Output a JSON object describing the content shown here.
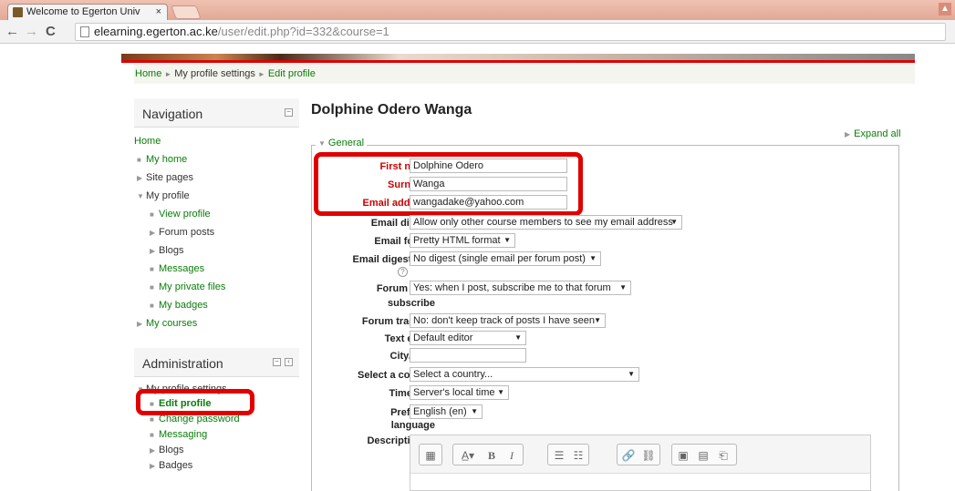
{
  "browser": {
    "tab_title": "Welcome to Egerton Univ",
    "tab_close": "×",
    "url_host": "elearning.egerton.ac.ke",
    "url_path": "/user/edit.php?id=332&course=1"
  },
  "breadcrumb": {
    "home": "Home",
    "profile_settings": "My profile settings",
    "current": "Edit profile",
    "separator": "►"
  },
  "navigation": {
    "title": "Navigation",
    "home": "Home",
    "my_home": "My home",
    "site_pages": "Site pages",
    "my_profile": "My profile",
    "view_profile": "View profile",
    "forum_posts": "Forum posts",
    "blogs": "Blogs",
    "messages": "Messages",
    "private_files": "My private files",
    "badges": "My badges",
    "my_courses": "My courses"
  },
  "administration": {
    "title": "Administration",
    "profile_settings": "My profile settings",
    "edit_profile": "Edit profile",
    "change_password": "Change password",
    "messaging": "Messaging",
    "blogs": "Blogs",
    "badges": "Badges"
  },
  "main": {
    "title": "Dolphine Odero Wanga",
    "expand_all": "Expand all",
    "section": "General"
  },
  "form": {
    "first_name_label": "First name",
    "first_name": "Dolphine Odero",
    "surname_label": "Surname",
    "surname": "Wanga",
    "email_label": "Email address",
    "email": "wangadake@yahoo.com",
    "email_display_label": "Email display",
    "email_display": "Allow only other course members to see my email address",
    "email_format_label": "Email format",
    "email_format": "Pretty HTML format",
    "digest_label": "Email digest type",
    "digest": "No digest (single email per forum post)",
    "autosub_label_1": "Forum auto-",
    "autosub_label_2": "subscribe",
    "autosub": "Yes: when I post, subscribe me to that forum",
    "tracking_label": "Forum tracking",
    "tracking": "No: don't keep track of posts I have seen",
    "editor_label": "Text editor",
    "editor": "Default editor",
    "city_label": "City/town",
    "city": "",
    "country_label": "Select a country",
    "country": "Select a country...",
    "timezone_label": "Timezone",
    "timezone": "Server's local time",
    "language_label_1": "Preferred",
    "language_label_2": "language",
    "language": "English (en)",
    "description_label": "Description"
  },
  "colors": {
    "link": "#0a7d0a",
    "highlight": "#e00000",
    "required": "#cc0000"
  }
}
